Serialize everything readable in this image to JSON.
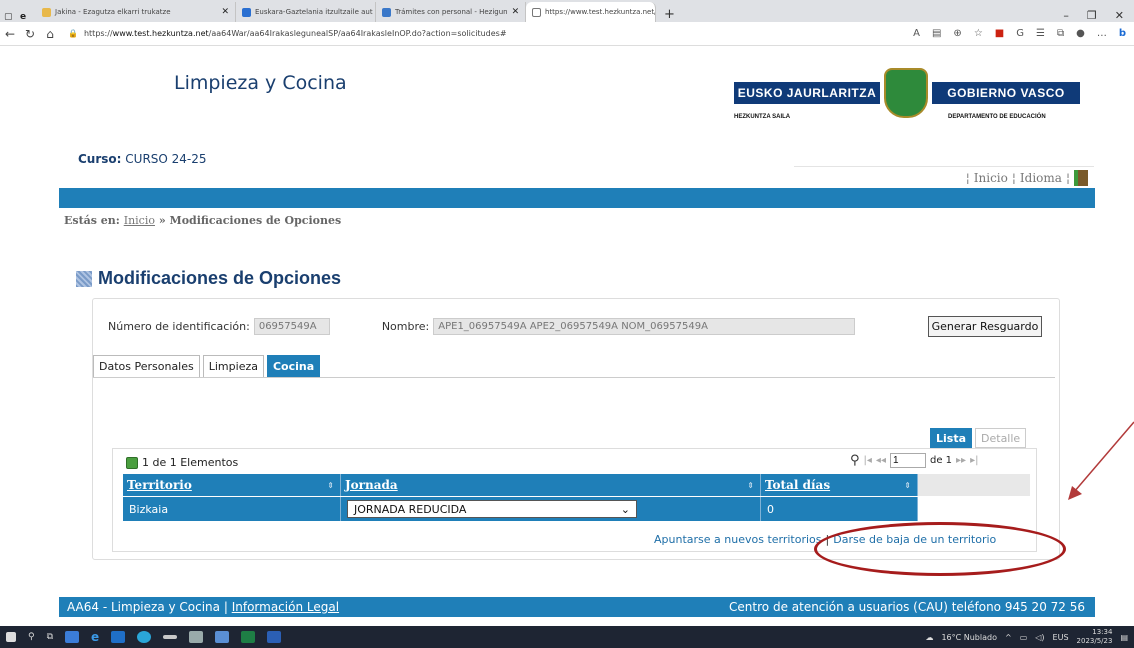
{
  "browser": {
    "tabs": [
      {
        "label": "Jakina - Ezagutza elkarri trukatze",
        "color": "#e8b84a"
      },
      {
        "label": "Euskara-Gaztelania itzultzaile aut",
        "color": "#2a6fd1"
      },
      {
        "label": "Trámites con personal - Hezigun",
        "color": "#3a78c9"
      },
      {
        "label": "https://www.test.hezkuntza.net/a",
        "color": "#ffffff"
      }
    ],
    "url_prefix": "https://",
    "url_domain": "www.test.hezkuntza.net",
    "url_path": "/aa64War/aa64IrakaslegunealSP/aa64IrakasleInOP.do?action=solicitudes#"
  },
  "header": {
    "brand": "Limpieza y Cocina",
    "logo_left": "EUSKO JAURLARITZA",
    "logo_right": "GOBIERNO VASCO",
    "logo_sub_left": "HEZKUNTZA SAILA",
    "logo_sub_right": "DEPARTAMENTO DE EDUCACIÓN",
    "curso_label": "Curso:",
    "curso_value": "CURSO 24-25",
    "nav_inicio": "Inicio",
    "nav_idioma": "Idioma"
  },
  "breadcrumb": {
    "label": "Estás en:",
    "home": "Inicio",
    "sep": "»",
    "current": "Modificaciones de Opciones"
  },
  "page_title": "Modificaciones de Opciones",
  "form": {
    "id_label": "Número de identificación:",
    "id_value": "06957549A",
    "name_label": "Nombre:",
    "name_value": "APE1_06957549A APE2_06957549A NOM_06957549A",
    "generate_button": "Generar Resguardo"
  },
  "tabs": [
    "Datos Personales",
    "Limpieza",
    "Cocina"
  ],
  "active_tab": "Cocina",
  "subtabs": [
    "Lista",
    "Detalle"
  ],
  "grid": {
    "count_text": "1 de 1 Elementos",
    "page_input": "1",
    "page_of": "de 1",
    "columns": [
      "Territorio",
      "Jornada",
      "Total días"
    ],
    "rows": [
      {
        "territorio": "Bizkaia",
        "jornada": "JORNADA REDUCIDA",
        "total": "0"
      }
    ]
  },
  "actions": {
    "add": "Apuntarse a nuevos territorios",
    "sep": "|",
    "remove": "Darse de baja de un territorio"
  },
  "footer": {
    "left_text": "AA64 - Limpieza y Cocina |",
    "legal_link": "Información Legal",
    "right_text": "Centro de atención a usuarios (CAU) teléfono 945 20 72 56"
  },
  "taskbar": {
    "weather": "16°C Nublado",
    "lang": "EUS",
    "time": "13:34",
    "date": "2023/5/23"
  },
  "colors": {
    "primary_blue": "#1f7fb8",
    "title_blue": "#1a3f6f",
    "annotation_red": "#a61c1c"
  }
}
